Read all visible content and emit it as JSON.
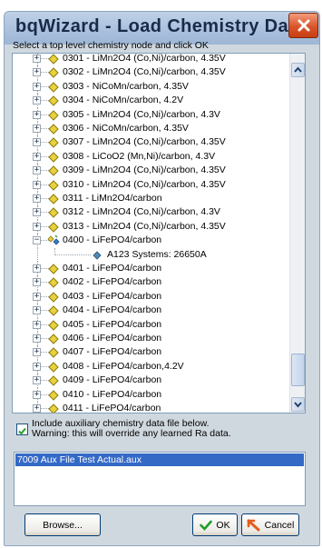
{
  "window": {
    "title": "bqWizard - Load Chemistry Data"
  },
  "instruction": "Select a top level chemistry node and click OK",
  "tree": {
    "rows": [
      {
        "label": "0301 - LiMn2O4 (Co,Ni)/carbon, 4.35V",
        "icon": "diamond-icon"
      },
      {
        "label": "0302 - LiMn2O4 (Co,Ni)/carbon, 4.35V",
        "icon": "diamond-icon"
      },
      {
        "label": "0303 - NiCoMn/carbon, 4.35V",
        "icon": "diamond-icon"
      },
      {
        "label": "0304 - NiCoMn/carbon, 4.2V",
        "icon": "diamond-icon"
      },
      {
        "label": "0305 - LiMn2O4 (Co,Ni)/carbon, 4.3V",
        "icon": "diamond-icon"
      },
      {
        "label": "0306 - NiCoMn/carbon, 4.35V",
        "icon": "diamond-icon"
      },
      {
        "label": "0307 - LiMn2O4 (Co,Ni)/carbon, 4.35V",
        "icon": "diamond-icon"
      },
      {
        "label": "0308 - LiCoO2 (Mn,Ni)/carbon, 4.3V",
        "icon": "diamond-icon"
      },
      {
        "label": "0309 - LiMn2O4 (Co,Ni)/carbon, 4.35V",
        "icon": "diamond-icon"
      },
      {
        "label": "0310 - LiMn2O4 (Co,Ni)/carbon, 4.35V",
        "icon": "diamond-icon"
      },
      {
        "label": "0311 - LiMn2O4/carbon",
        "icon": "diamond-icon"
      },
      {
        "label": "0312 - LiMn2O4 (Co,Ni)/carbon, 4.3V",
        "icon": "diamond-icon"
      },
      {
        "label": "0313 - LiMn2O4 (Co,Ni)/carbon, 4.35V",
        "icon": "diamond-icon"
      },
      {
        "label": "0400 - LiFePO4/carbon",
        "icon": "expanded-node-icon",
        "expanded": true
      },
      {
        "label": "A123 Systems: 26650A",
        "icon": "cell-icon",
        "child": true
      },
      {
        "label": "0401 - LiFePO4/carbon",
        "icon": "diamond-icon"
      },
      {
        "label": "0402 - LiFePO4/carbon",
        "icon": "diamond-icon"
      },
      {
        "label": "0403 - LiFePO4/carbon",
        "icon": "diamond-icon"
      },
      {
        "label": "0404 - LiFePO4/carbon",
        "icon": "diamond-icon"
      },
      {
        "label": "0405 - LiFePO4/carbon",
        "icon": "diamond-icon"
      },
      {
        "label": "0406 - LiFePO4/carbon",
        "icon": "diamond-icon"
      },
      {
        "label": "0407 - LiFePO4/carbon",
        "icon": "diamond-icon"
      },
      {
        "label": "0408 - LiFePO4/carbon,4.2V",
        "icon": "diamond-icon"
      },
      {
        "label": "0409 - LiFePO4/carbon",
        "icon": "diamond-icon"
      },
      {
        "label": "0410 - LiFePO4/carbon",
        "icon": "diamond-icon"
      },
      {
        "label": "0411 - LiFePO4/carbon",
        "icon": "diamond-icon"
      }
    ]
  },
  "aux": {
    "checked": true,
    "line1": "Include auxiliary chemistry data file below.",
    "line2": "Warning: this will override any learned Ra data."
  },
  "file_list": {
    "selected": "7009 Aux File Test Actual.aux"
  },
  "buttons": {
    "browse": "Browse...",
    "ok": "OK",
    "cancel": "Cancel"
  },
  "colors": {
    "accent": "#3469c6",
    "diamond": "#e8d23c",
    "close": "#d9542a"
  }
}
